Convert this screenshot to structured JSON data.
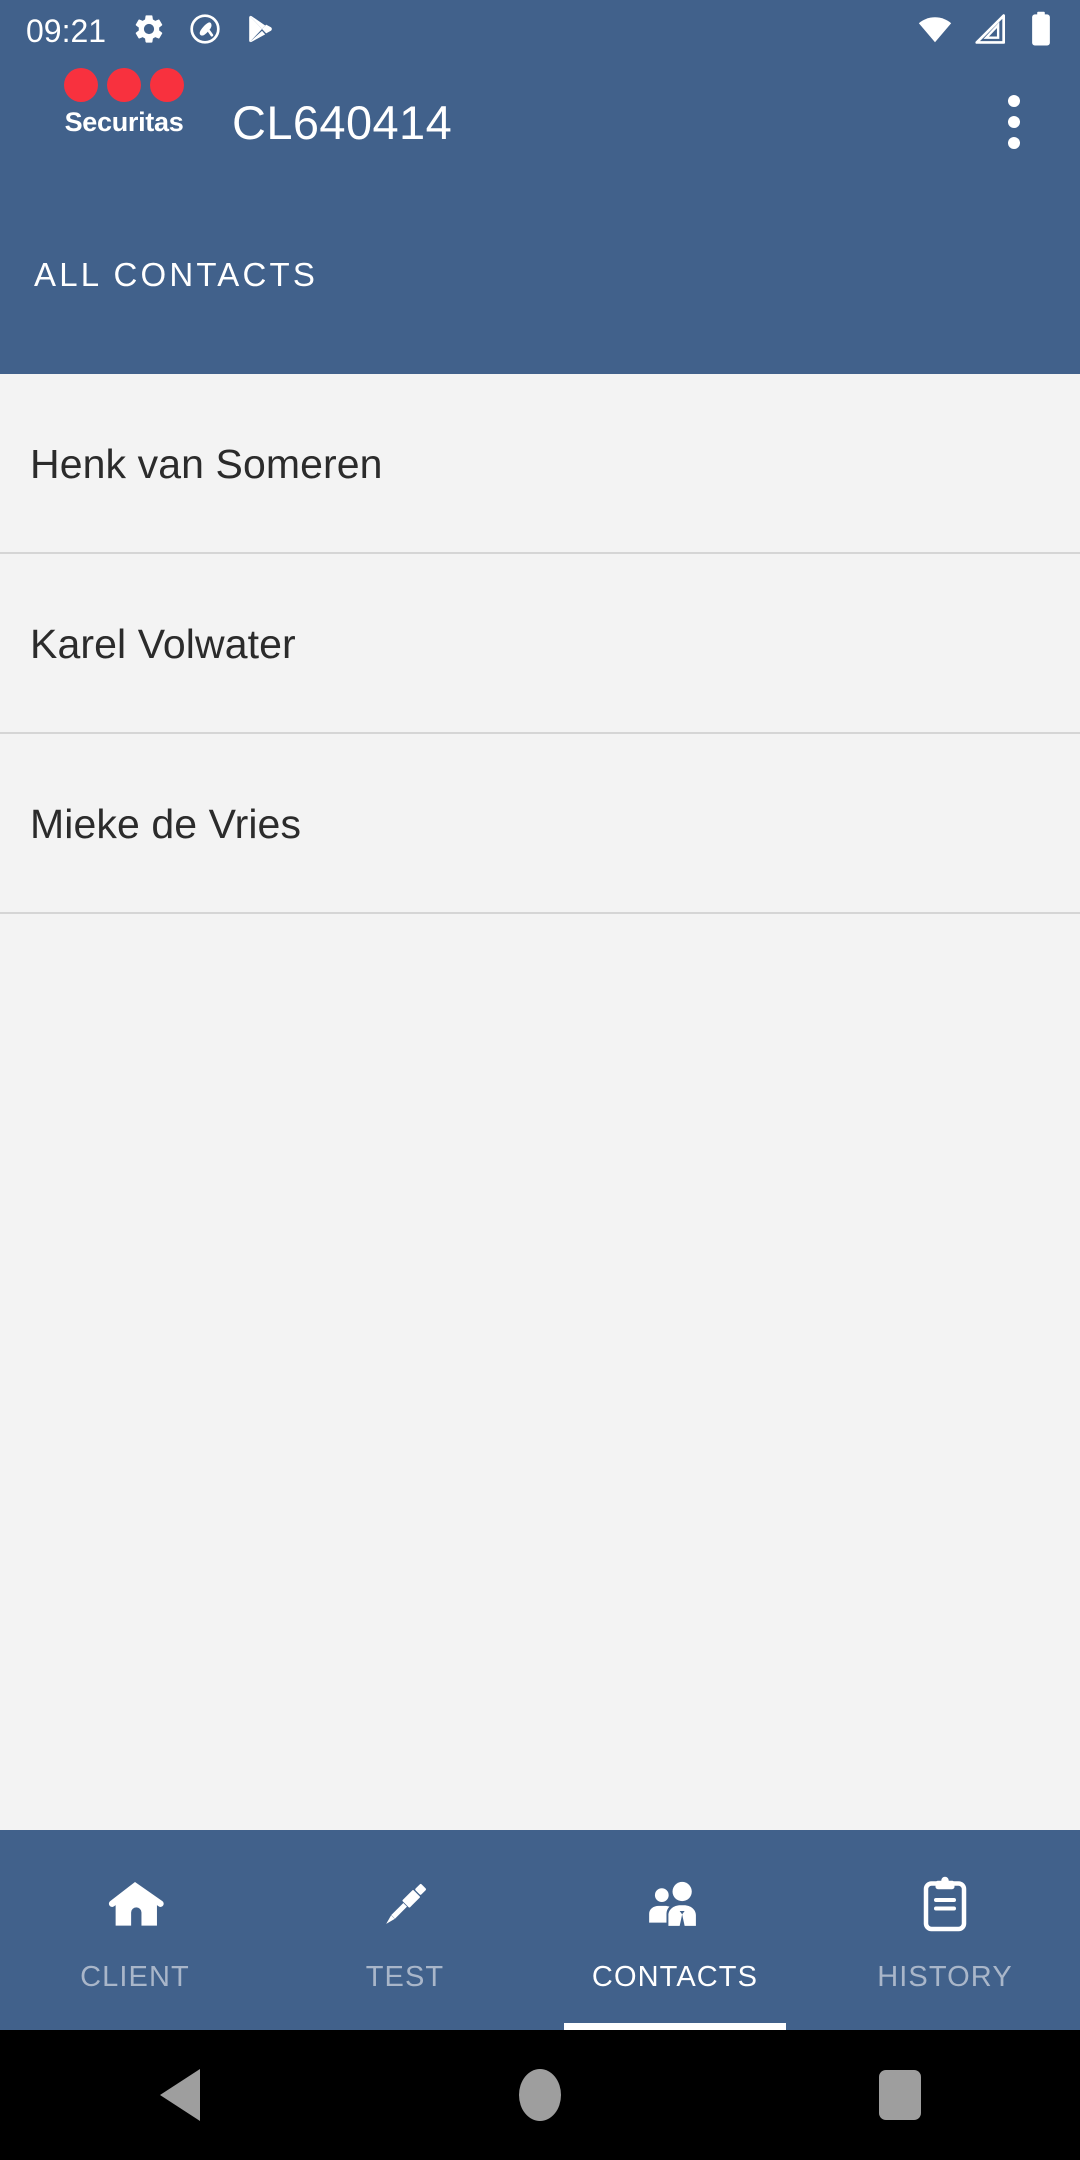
{
  "status_bar": {
    "clock": "09:21",
    "left_icons": [
      "gear-icon",
      "android-q-icon",
      "play-store-icon"
    ],
    "right_icons": [
      "wifi-icon",
      "cellular-signal-icon",
      "battery-icon"
    ],
    "background_color": "#41618B",
    "foreground_color": "#FFFFFF"
  },
  "app_bar": {
    "brand_name": "Securitas",
    "brand_dot_color": "#F8313E",
    "brand_dot_count": 3,
    "title": "CL640414",
    "overflow_menu_icon": "more-vert-icon",
    "background_color": "#41618B"
  },
  "section_tabs": {
    "active_tab_label": "ALL CONTACTS"
  },
  "contacts": {
    "items": [
      {
        "name": "Henk van Someren"
      },
      {
        "name": "Karel Volwater"
      },
      {
        "name": "Mieke de Vries"
      }
    ],
    "background_color": "#F3F3F3",
    "divider_color": "#D5D5D5",
    "text_color": "#2B2B2B"
  },
  "bottom_nav": {
    "background_color": "#41618B",
    "active_color": "#FFFFFF",
    "inactive_color": "#A9B6C9",
    "items": [
      {
        "label": "CLIENT",
        "icon": "home-icon",
        "active": false
      },
      {
        "label": "TEST",
        "icon": "screwdriver-icon",
        "active": false
      },
      {
        "label": "CONTACTS",
        "icon": "people-icon",
        "active": true
      },
      {
        "label": "HISTORY",
        "icon": "clipboard-icon",
        "active": false
      }
    ]
  },
  "system_nav": {
    "background_color": "#000000",
    "icon_color": "#9E9E9E",
    "buttons": [
      "back-icon",
      "home-icon",
      "recents-icon"
    ]
  }
}
